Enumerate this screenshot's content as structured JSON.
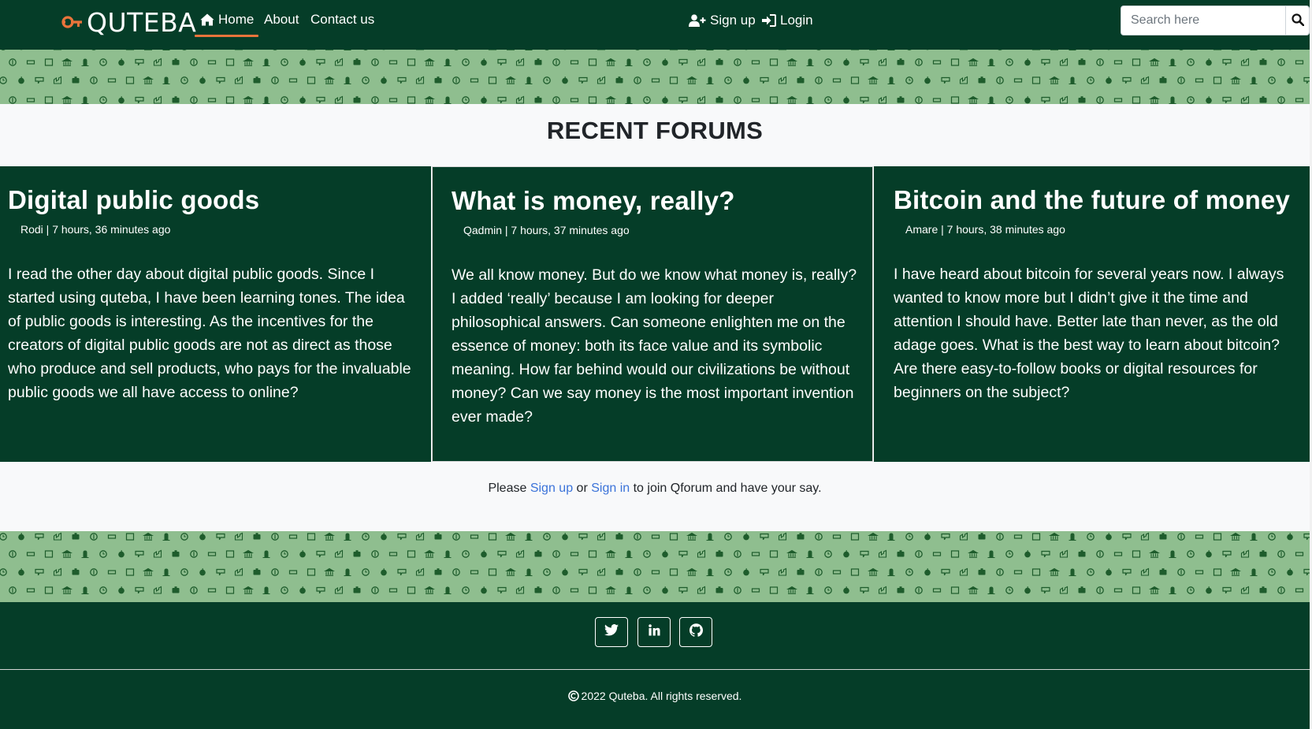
{
  "colors": {
    "brand_dark_green": "#053d28",
    "pattern_green": "#8fbe8f",
    "pattern_icon": "#1e5c2c",
    "accent_orange": "#e8743b",
    "link_blue": "#3b73d9"
  },
  "navbar": {
    "brand": "QUTEBA",
    "brand_icon": "key-logo-icon",
    "links": [
      {
        "label": "Home",
        "icon": "home-icon",
        "active": true
      },
      {
        "label": "About"
      },
      {
        "label": "Contact us"
      }
    ],
    "auth": {
      "signup": {
        "label": "Sign up",
        "icon": "user-plus-icon"
      },
      "login": {
        "label": "Login",
        "icon": "sign-in-icon"
      }
    },
    "search": {
      "placeholder": "Search here",
      "value": "",
      "icon": "search-icon"
    }
  },
  "forums": {
    "title": "RECENT FORUMS",
    "posts": [
      {
        "title": "Digital public goods",
        "meta": "Rodi | 7 hours, 36 minutes ago",
        "body": "I read the other day about digital public goods. Since I started using quteba, I have been learning tones. The idea of public goods is interesting. As the incentives for the creators of digital public goods are not as direct as those who produce and sell products, who pays for the invaluable public goods we all have access to online?"
      },
      {
        "title": "What is money, really?",
        "meta": "Qadmin | 7 hours, 37 minutes ago",
        "body": "We all know money. But do we know what money is, really? I added ‘really’ because I am looking for deeper philosophical answers. Can someone enlighten me on the essence of money: both its face value and its symbolic meaning. How far behind would our civilizations be without money? Can we say money is the most important invention ever made?"
      },
      {
        "title": "Bitcoin and the future of money",
        "meta": "Amare | 7 hours, 38 minutes ago",
        "body": "I have heard about bitcoin for several years now. I always wanted to know more but I didn’t give it the time and attention I should have. Better late than never, as the old adage goes. What is the best way to learn about bitcoin? Are there easy-to-follow books or digital resources for beginners on the subject?"
      }
    ],
    "join": {
      "prefix": "Please",
      "signup_link": "Sign up",
      "middle": "or",
      "signin_link": "Sign in",
      "suffix": "to join Qforum and have your say."
    }
  },
  "footer": {
    "social": [
      {
        "icon": "twitter-icon"
      },
      {
        "icon": "linkedin-icon"
      },
      {
        "icon": "github-icon"
      }
    ],
    "copyright": "2022 Quteba. All rights reserved.",
    "copyright_icon": "copyright-icon"
  }
}
